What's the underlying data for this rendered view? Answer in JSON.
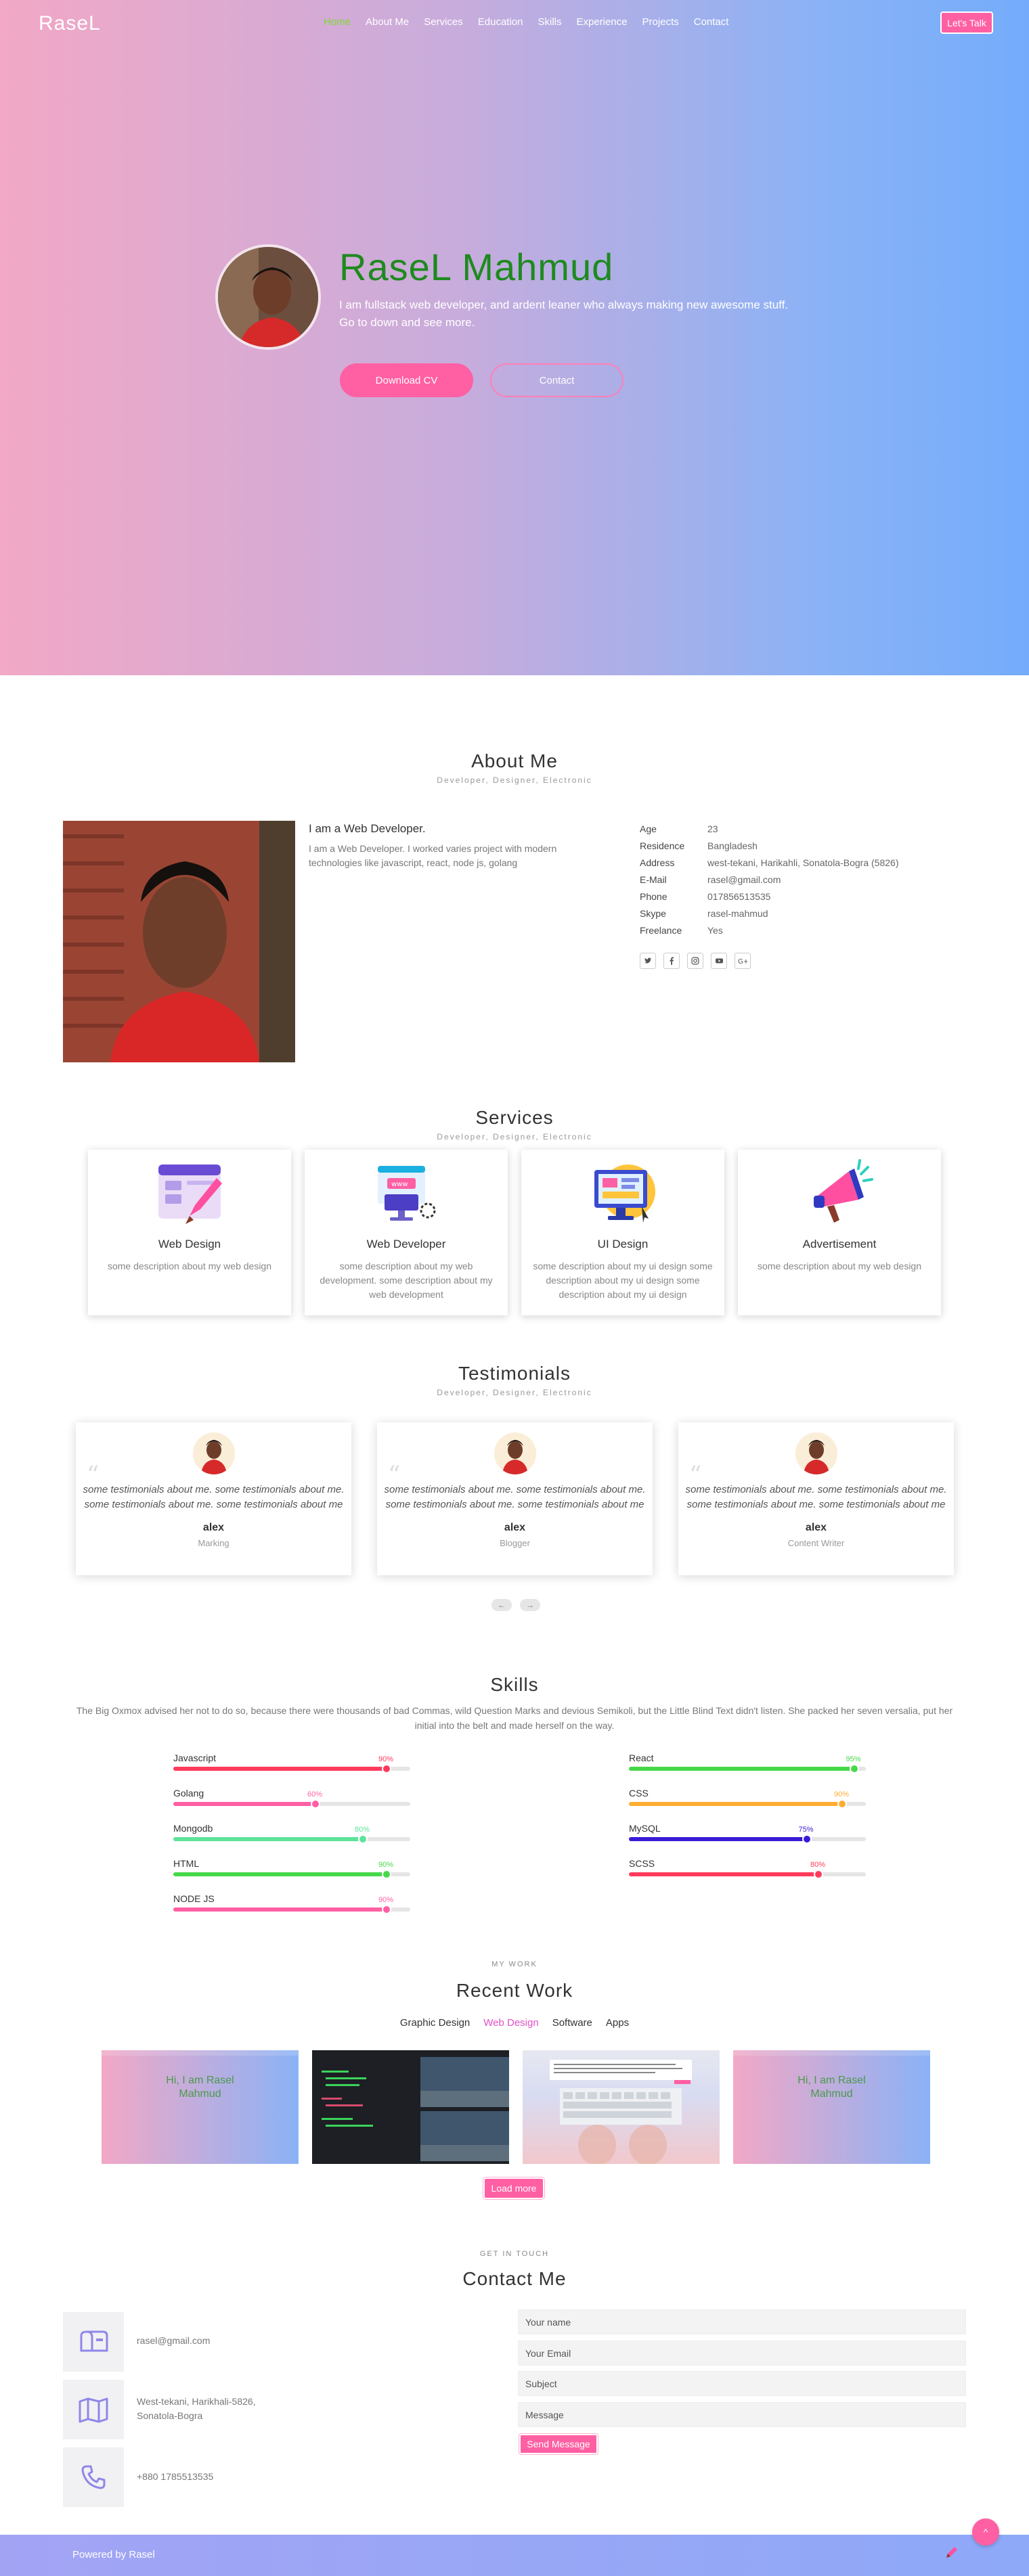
{
  "logo": "RaseL",
  "nav": [
    "Home",
    "About Me",
    "Services",
    "Education",
    "Skills",
    "Experience",
    "Projects",
    "Contact"
  ],
  "nav_active": "Home",
  "header_button": "Let's Talk",
  "hero": {
    "name": "RaseL Mahmud",
    "description": "I am fullstack web developer, and ardent leaner who always making new awesome stuff. Go to down and see more.",
    "btn_cv": "Download CV",
    "btn_contact": "Contact"
  },
  "about": {
    "title": "About Me",
    "subtitle": "Developer, Designer, Electronic",
    "heading": "I am a Web Developer.",
    "text": "I am a Web Developer. I worked varies project with modern technologies like javascript, react, node js, golang",
    "info": [
      {
        "k": "Age",
        "v": "23"
      },
      {
        "k": "Residence",
        "v": "Bangladesh"
      },
      {
        "k": "Address",
        "v": "west-tekani, Harikahli, Sonatola-Bogra (5826)"
      },
      {
        "k": "E-Mail",
        "v": "rasel@gmail.com"
      },
      {
        "k": "Phone",
        "v": "017856513535"
      },
      {
        "k": "Skype",
        "v": "rasel-mahmud"
      },
      {
        "k": "Freelance",
        "v": "Yes"
      }
    ],
    "socials": [
      "twitter-icon",
      "facebook-icon",
      "instagram-icon",
      "youtube-icon",
      "google-plus-icon"
    ]
  },
  "services": {
    "title": "Services",
    "subtitle": "Developer, Designer, Electronic",
    "items": [
      {
        "title": "Web Design",
        "desc": "some description about my web design",
        "icon": "web-design-icon"
      },
      {
        "title": "Web Developer",
        "desc": "some description about my web development. some description about my web development",
        "icon": "web-developer-icon"
      },
      {
        "title": "UI Design",
        "desc": "some description about my ui design some description about my ui design some description about my ui design",
        "icon": "ui-design-icon"
      },
      {
        "title": "Advertisement",
        "desc": "some description about my web design",
        "icon": "megaphone-icon"
      }
    ]
  },
  "testimonials": {
    "title": "Testimonials",
    "subtitle": "Developer, Designer, Electronic",
    "items": [
      {
        "text": "some testimonials about me. some testimonials about me. some testimonials about me. some testimonials about me",
        "name": "alex",
        "role": "Marking"
      },
      {
        "text": "some testimonials about me. some testimonials about me. some testimonials about me. some testimonials about me",
        "name": "alex",
        "role": "Blogger"
      },
      {
        "text": "some testimonials about me. some testimonials about me. some testimonials about me. some testimonials about me",
        "name": "alex",
        "role": "Content Writer"
      }
    ],
    "prev": "←",
    "next": "→"
  },
  "skills": {
    "title": "Skills",
    "text": "The Big Oxmox advised her not to do so, because there were thousands of bad Commas, wild Question Marks and devious Semikoli, but the Little Blind Text didn't listen. She packed her seven versalia, put her initial into the belt and made herself on the way.",
    "left": [
      {
        "name": "Javascript",
        "pct": 90,
        "label": "90%",
        "color": "#ff3b5c"
      },
      {
        "name": "Golang",
        "pct": 60,
        "label": "60%",
        "color": "#ff5fa3"
      },
      {
        "name": "Mongodb",
        "pct": 80,
        "label": "80%",
        "color": "#5ee39b"
      },
      {
        "name": "HTML",
        "pct": 90,
        "label": "90%",
        "color": "#47d84a"
      },
      {
        "name": "NODE JS",
        "pct": 90,
        "label": "90%",
        "color": "#ff5fa3"
      }
    ],
    "right": [
      {
        "name": "React",
        "pct": 95,
        "label": "95%",
        "color": "#47d84a"
      },
      {
        "name": "CSS",
        "pct": 90,
        "label": "90%",
        "color": "#ffae33"
      },
      {
        "name": "MySQL",
        "pct": 75,
        "label": "75%",
        "color": "#3a1ad6"
      },
      {
        "name": "SCSS",
        "pct": 80,
        "label": "80%",
        "color": "#ff3b5c"
      }
    ]
  },
  "work": {
    "eyebrow": "MY WORK",
    "title": "Recent Work",
    "filters": [
      "Graphic Design",
      "Web Design",
      "Software",
      "Apps"
    ],
    "filter_active": "Web Design",
    "thumb_text": [
      "Hi, I am Rasel",
      "Mahmud"
    ],
    "load_more": "Load more"
  },
  "contact": {
    "eyebrow": "GET IN TOUCH",
    "title": "Contact Me",
    "email": "rasel@gmail.com",
    "address_line1": "West-tekani, Harikhali-5826,",
    "address_line2": "Sonatola-Bogra",
    "phone": "+880 1785513535",
    "form": {
      "name": "Your name",
      "email": "Your Email",
      "subject": "Subject",
      "message": "Message",
      "send": "Send Message"
    }
  },
  "footer": {
    "text": "Powered by Rasel",
    "totop": "^"
  }
}
